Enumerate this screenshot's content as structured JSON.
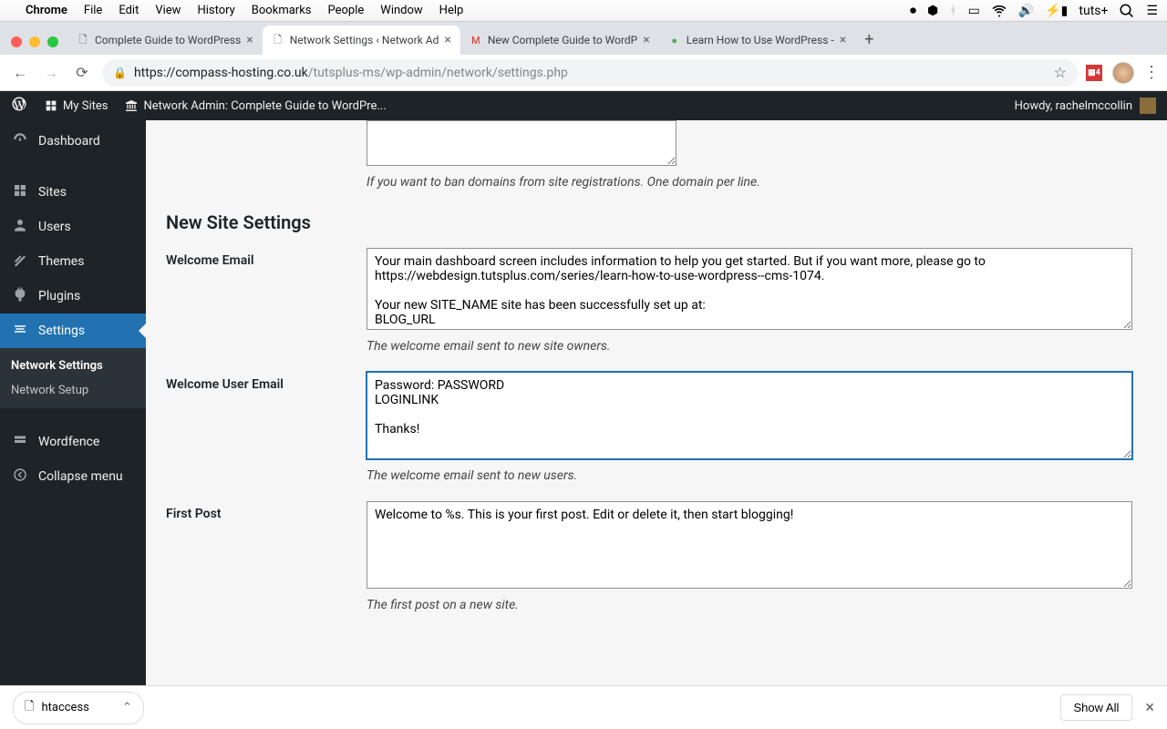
{
  "macos": {
    "app_name": "Chrome",
    "menus": [
      "File",
      "Edit",
      "View",
      "History",
      "Bookmarks",
      "People",
      "Window",
      "Help"
    ],
    "right_label": "tuts+"
  },
  "chrome": {
    "tabs": [
      {
        "title": "Complete Guide to WordPress",
        "active": false
      },
      {
        "title": "Network Settings ‹ Network Ad",
        "active": true
      },
      {
        "title": "New Complete Guide to WordP",
        "active": false
      },
      {
        "title": "Learn How to Use WordPress -",
        "active": false
      }
    ],
    "url_host": "https://compass-hosting.co.uk",
    "url_path": "/tutsplus-ms/wp-admin/network/settings.php"
  },
  "wp_adminbar": {
    "my_sites": "My Sites",
    "network_admin": "Network Admin: Complete Guide to WordPre...",
    "howdy": "Howdy, rachelmccollin"
  },
  "wp_sidebar": {
    "items": [
      {
        "label": "Dashboard",
        "icon": "dashboard"
      },
      {
        "label": "Sites",
        "icon": "sites"
      },
      {
        "label": "Users",
        "icon": "users"
      },
      {
        "label": "Themes",
        "icon": "themes"
      },
      {
        "label": "Plugins",
        "icon": "plugins"
      },
      {
        "label": "Settings",
        "icon": "settings",
        "active": true
      },
      {
        "label": "Wordfence",
        "icon": "wordfence"
      },
      {
        "label": "Collapse menu",
        "icon": "collapse"
      }
    ],
    "submenu": [
      {
        "label": "Network Settings",
        "active": true
      },
      {
        "label": "Network Setup",
        "active": false
      }
    ]
  },
  "content": {
    "banned_help": "If you want to ban domains from site registrations. One domain per line.",
    "section_title": "New Site Settings",
    "welcome_email": {
      "label": "Welcome Email",
      "value": "Your main dashboard screen includes information to help you get started. But if you want more, please go to https://webdesign.tutsplus.com/series/learn-how-to-use-wordpress--cms-1074.\n\nYour new SITE_NAME site has been successfully set up at:\nBLOG_URL",
      "desc": "The welcome email sent to new site owners."
    },
    "welcome_user_email": {
      "label": "Welcome User Email",
      "value": "Password: PASSWORD\nLOGINLINK\n\nThanks!\n",
      "desc": "The welcome email sent to new users."
    },
    "first_post": {
      "label": "First Post",
      "value": "Welcome to %s. This is your first post. Edit or delete it, then start blogging!",
      "desc": "The first post on a new site."
    }
  },
  "download": {
    "filename": "htaccess",
    "show_all": "Show All"
  }
}
